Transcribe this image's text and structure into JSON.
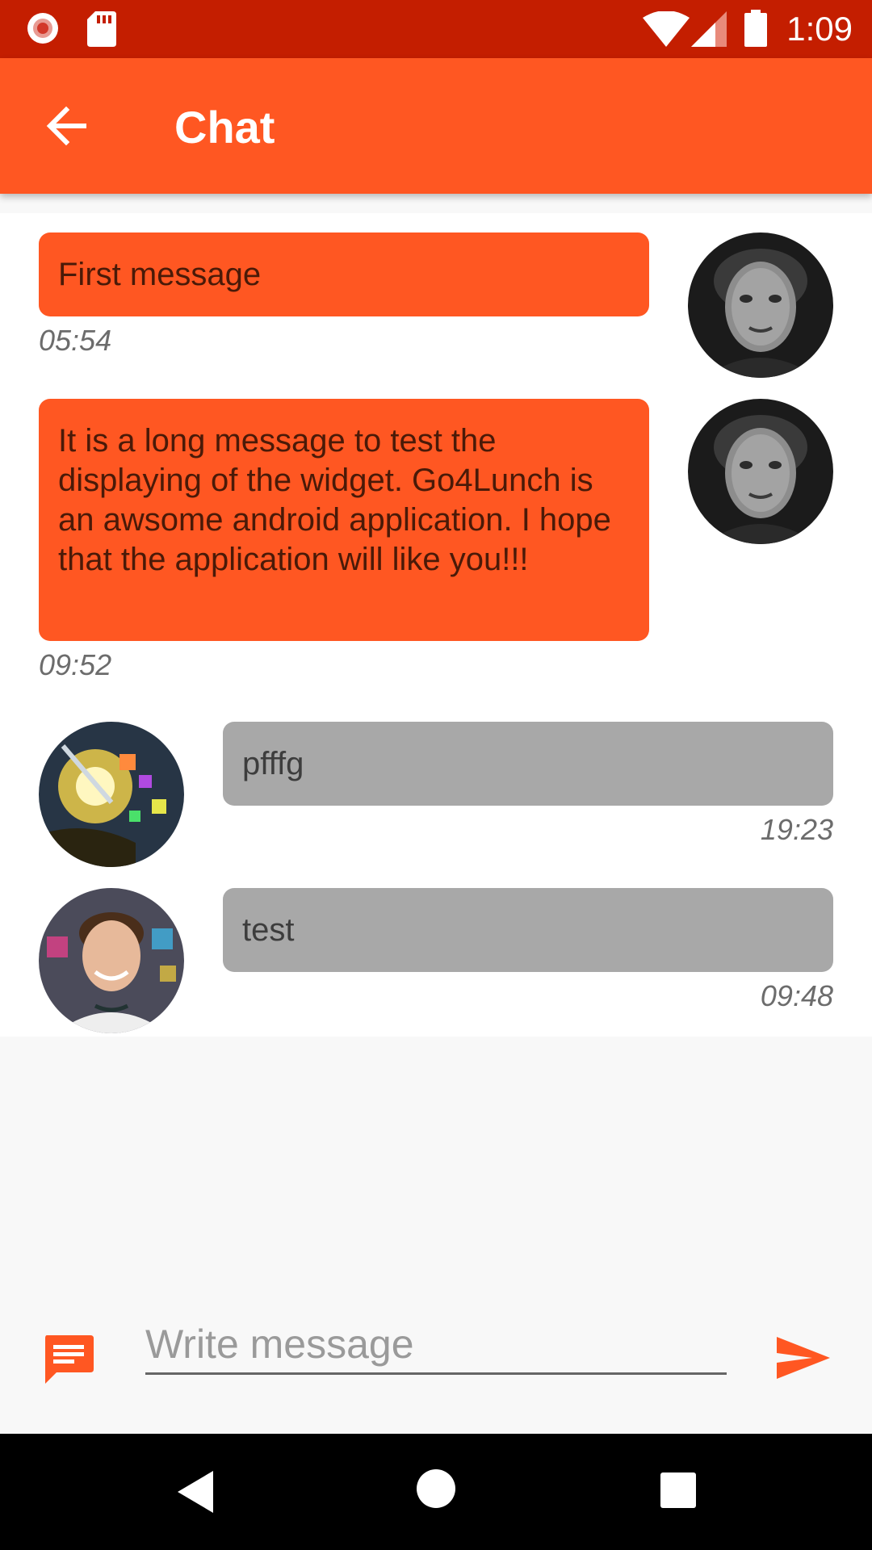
{
  "status_bar": {
    "time": "1:09",
    "icons": [
      "record-icon",
      "sd-card-icon",
      "wifi-icon",
      "signal-icon",
      "battery-icon"
    ]
  },
  "app_bar": {
    "title": "Chat",
    "back_icon": "arrow-back-icon",
    "color": "#ff5722"
  },
  "messages": [
    {
      "text": "First message",
      "time": "05:54",
      "side": "right",
      "avatar": "user-avatar-dark-portrait"
    },
    {
      "text": "It is a long message to test the displaying of the widget.  Go4Lunch is an awsome android application. I hope that the application will like you!!!",
      "time": "09:52",
      "side": "right",
      "avatar": "user-avatar-dark-portrait"
    },
    {
      "text": "pfffg",
      "time": "19:23",
      "side": "left",
      "avatar": "user-avatar-colorful-icons"
    },
    {
      "text": "test",
      "time": "09:48",
      "side": "left",
      "avatar": "user-avatar-smiling-man"
    }
  ],
  "input_bar": {
    "placeholder": "Write message",
    "value": "",
    "left_icon": "chat-bubble-icon",
    "send_icon": "send-icon"
  },
  "nav_bar": {
    "icons": [
      "nav-back-icon",
      "nav-home-icon",
      "nav-recents-icon"
    ]
  },
  "colors": {
    "status_bar": "#c41e00",
    "accent": "#ff5722",
    "other_bubble": "#a8a8a8",
    "background": "#f8f8f8"
  }
}
